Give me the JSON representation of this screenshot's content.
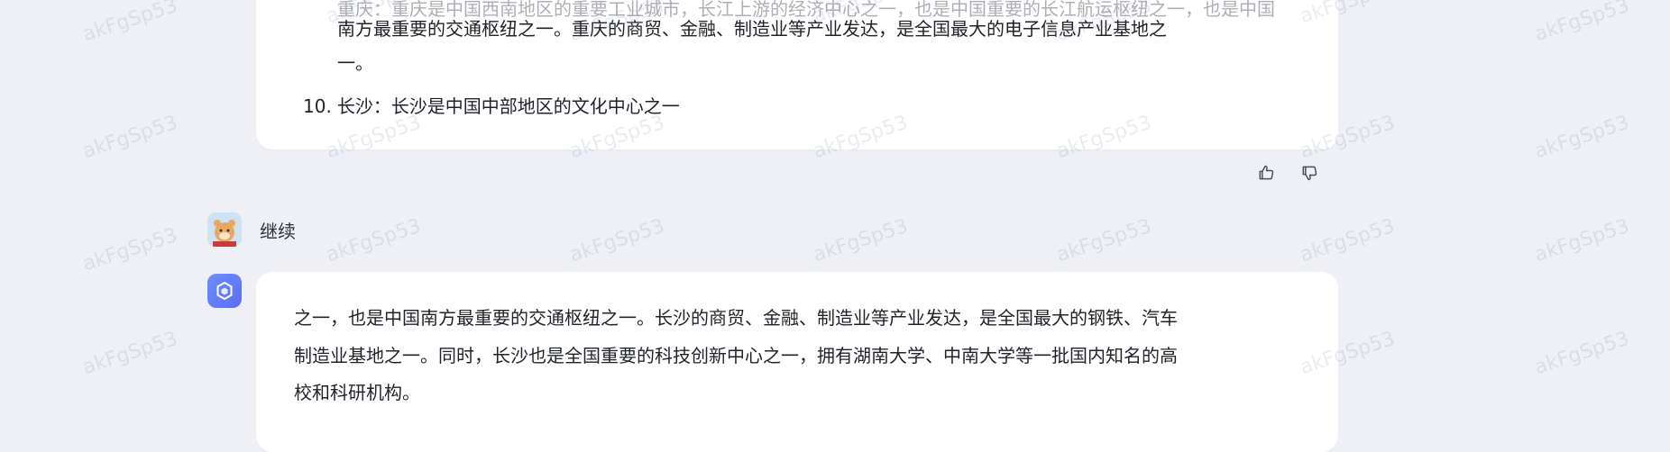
{
  "previous_answer": {
    "partial_line_top": "重庆：重庆是中国西南地区的重要工业城市，长江上游的经济中心之一，也是中国重要的长江航运枢纽之一，也是中国",
    "line1": "南方最重要的交通枢纽之一。重庆的商贸、金融、制造业等产业发达，是全国最大的电子信息产业基地之",
    "line2": "一。",
    "list_item_10_number": "10.",
    "list_item_10_text": "长沙：长沙是中国中部地区的文化中心之一"
  },
  "feedback": {
    "like_icon": "thumbs-up-icon",
    "dislike_icon": "thumbs-down-icon"
  },
  "user_message": {
    "text": "继续"
  },
  "bot_answer": {
    "line1": "之一，也是中国南方最重要的交通枢纽之一。长沙的商贸、金融、制造业等产业发达，是全国最大的钢铁、汽车",
    "line2": "制造业基地之一。同时，长沙也是全国重要的科技创新中心之一，拥有湖南大学、中南大学等一批国内知名的高",
    "line3": "校和科研机构。"
  },
  "watermark": {
    "text": "akFgSp53"
  },
  "colors": {
    "background": "#eef0f6",
    "card": "#ffffff",
    "bot_avatar": "#5c6cf5"
  }
}
